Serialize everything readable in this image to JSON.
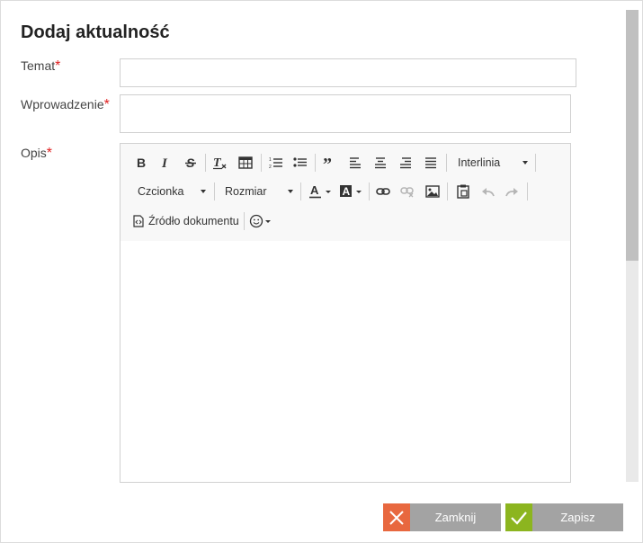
{
  "dialog": {
    "title": "Dodaj aktualność",
    "required_marker": "*",
    "fields": {
      "temat_label": "Temat",
      "wprowadzenie_label": "Wprowadzenie",
      "opis_label": "Opis"
    }
  },
  "editor": {
    "interlinia_label": "Interlinia",
    "font_label": "Czcionka",
    "size_label": "Rozmiar",
    "source_label": "Źródło dokumentu"
  },
  "buttons": {
    "close_label": "Zamknij",
    "save_label": "Zapisz"
  },
  "colors": {
    "close_accent": "#e8683f",
    "save_accent": "#8cb51f",
    "button_gray": "#a3a3a3",
    "required": "#e02020"
  }
}
